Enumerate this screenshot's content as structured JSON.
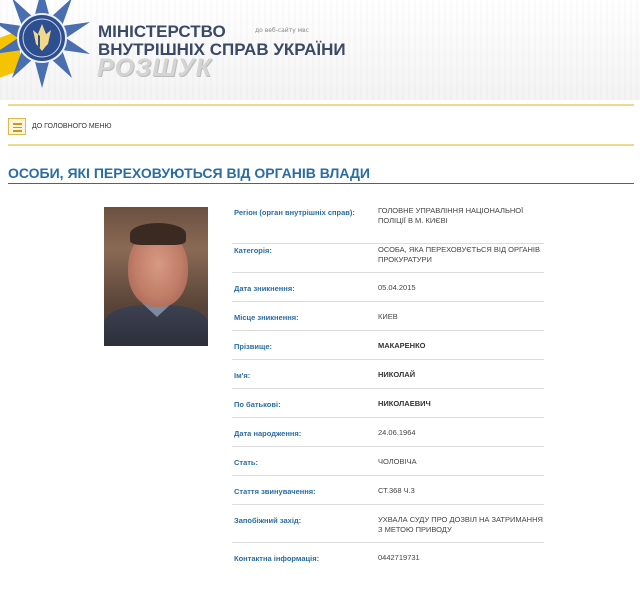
{
  "header": {
    "ministry_line1": "МІНІСТЕРСТВО",
    "ministry_line2": "ВНУТРІШНІХ СПРАВ УКРАЇНИ",
    "site_link": "до веб-сайту мвс",
    "section": "РОЗШУК"
  },
  "menu": {
    "main_menu_label": "ДО ГОЛОВНОГО МЕНЮ"
  },
  "page": {
    "title": "ОСОБИ, ЯКІ ПЕРЕХОВУЮТЬСЯ ВІД ОРГАНІВ ВЛАДИ"
  },
  "person": {
    "fields": [
      {
        "label": "Регіон (орган внутрішніх справ):",
        "value": "ГОЛОВНЕ УПРАВЛІННЯ НАЦІОНАЛЬНОЇ ПОЛІЦІЇ В М. КИЄВІ"
      },
      {
        "label": "Категорія:",
        "value": "ОСОБА, ЯКА ПЕРЕХОВУЄТЬСЯ ВІД ОРГАНІВ ПРОКУРАТУРИ"
      },
      {
        "label": "Дата зникнення:",
        "value": "05.04.2015"
      },
      {
        "label": "Місце зникнення:",
        "value": "КИЕВ"
      },
      {
        "label": "Прізвище:",
        "value": "МАКАРЕНКО"
      },
      {
        "label": "Ім'я:",
        "value": "НИКОЛАЙ"
      },
      {
        "label": "По батькові:",
        "value": "НИКОЛАЕВИЧ"
      },
      {
        "label": "Дата народження:",
        "value": "24.06.1964"
      },
      {
        "label": "Стать:",
        "value": "ЧОЛОВІЧА"
      },
      {
        "label": "Стаття звинувачення:",
        "value": "СТ.368 Ч.3"
      },
      {
        "label": "Запобіжний захід:",
        "value": "УХВАЛА СУДУ ПРО ДОЗВІЛ НА ЗАТРИМАННЯ З МЕТОЮ ПРИВОДУ"
      },
      {
        "label": "Контактна інформація:",
        "value": "0442719731"
      }
    ]
  },
  "colors": {
    "accent_blue": "#2a6ca3",
    "gold": "#f0d98a",
    "emblem_blue": "#2d4f8f"
  }
}
